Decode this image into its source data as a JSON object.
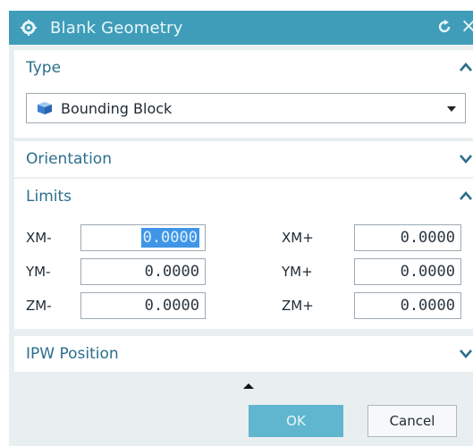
{
  "dialog": {
    "title": "Blank Geometry",
    "close_glyph": "×",
    "icons": {
      "title": "gear-icon",
      "reset": "reset-icon",
      "close": "close-icon"
    }
  },
  "type_section": {
    "header": "Type",
    "state": "expanded",
    "dropdown_value": "Bounding Block",
    "dropdown_icon": "cube-icon"
  },
  "orientation_section": {
    "header": "Orientation",
    "state": "collapsed"
  },
  "limits_section": {
    "header": "Limits",
    "state": "expanded",
    "fields": {
      "xm_minus": {
        "label": "XM-",
        "value": "0.0000"
      },
      "xm_plus": {
        "label": "XM+",
        "value": "0.0000"
      },
      "ym_minus": {
        "label": "YM-",
        "value": "0.0000"
      },
      "ym_plus": {
        "label": "YM+",
        "value": "0.0000"
      },
      "zm_minus": {
        "label": "ZM-",
        "value": "0.0000"
      },
      "zm_plus": {
        "label": "ZM+",
        "value": "0.0000"
      }
    }
  },
  "ipw_section": {
    "header": "IPW Position",
    "state": "collapsed"
  },
  "buttons": {
    "ok": "OK",
    "cancel": "Cancel"
  },
  "colors": {
    "title_bar": "#3f9db9",
    "section_header_text": "#2b6f8c",
    "ok_button": "#5fb6ce",
    "selection": "#3f96e6"
  }
}
